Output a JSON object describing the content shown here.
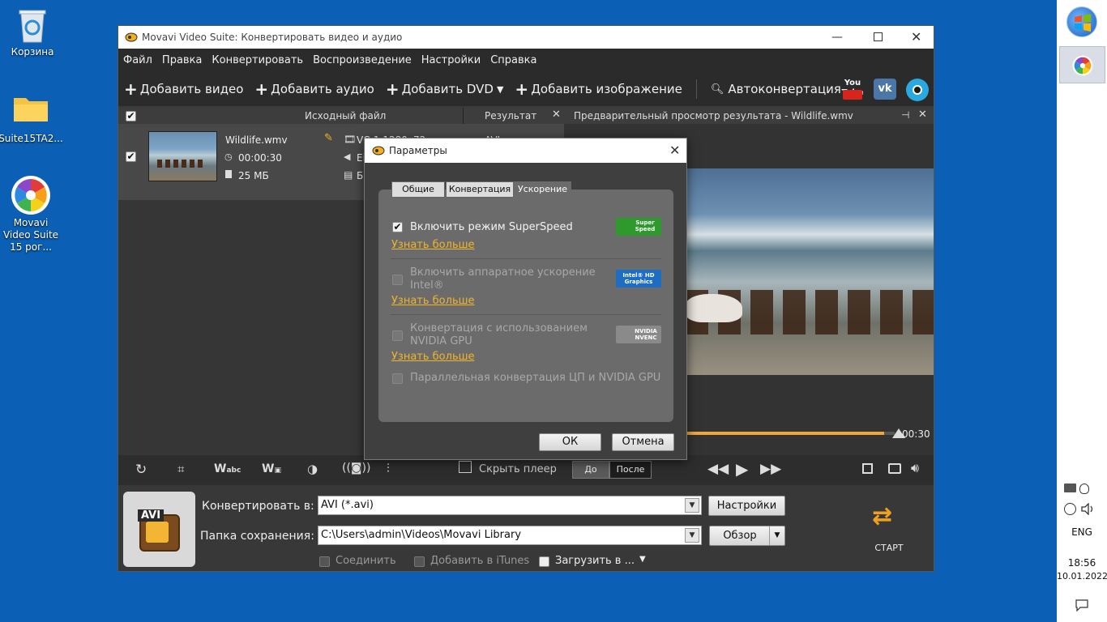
{
  "desktop": {
    "icons": [
      {
        "label": "Корзина"
      },
      {
        "label": "Suite15TA2..."
      },
      {
        "label": "Movavi Video Suite 15 рог..."
      }
    ]
  },
  "taskbar": {
    "lang": "ENG",
    "time": "18:56",
    "date": "10.01.2022"
  },
  "window": {
    "title": "Movavi Video Suite: Конвертировать видео и аудио",
    "menu": [
      "Файл",
      "Правка",
      "Конвертировать",
      "Воспроизведение",
      "Настройки",
      "Справка"
    ],
    "toolbar": {
      "add_video": "Добавить видео",
      "add_audio": "Добавить аудио",
      "add_dvd": "Добавить DVD",
      "add_image": "Добавить изображение",
      "autoconvert": "Автоконвертация",
      "youtube": "You Tube"
    },
    "list": {
      "col_source": "Исходный файл",
      "col_result": "Результат",
      "file_name": "Wildlife.wmv",
      "duration": "00:00:30",
      "size": "25 МБ",
      "codec": "VC-1 1280x72",
      "audio": "Ei",
      "subs": "Бе",
      "result_format": "AVI"
    },
    "preview": {
      "title": "Предварительный просмотр результата - Wildlife.wmv",
      "time_end": "00:30",
      "progress_fraction": 0.95
    },
    "controls": {
      "hide_player": "Скрыть плеер",
      "before": "До",
      "after": "После"
    },
    "bottom": {
      "format_badge": "AVI",
      "convert_to_label": "Конвертировать в:",
      "convert_to_value": "AVI (*.avi)",
      "settings_btn": "Настройки",
      "save_folder_label": "Папка сохранения:",
      "save_folder_value": "C:\\Users\\admin\\Videos\\Movavi Library",
      "browse_btn": "Обзор",
      "join_label": "Соединить",
      "itunes_label": "Добавить в iTunes",
      "upload_label": "Загрузить в ...",
      "start_label": "СТАРТ"
    }
  },
  "dialog": {
    "title": "Параметры",
    "tabs": [
      "Общие",
      "Конвертация",
      "Ускорение"
    ],
    "options": [
      {
        "label": "Включить режим SuperSpeed",
        "checked": true,
        "enabled": true,
        "badge": "Super Speed"
      },
      {
        "label": "Включить аппаратное ускорение Intel®",
        "checked": false,
        "enabled": false,
        "badge": "Intel® HD Graphics"
      },
      {
        "label": "Конвертация с использованием NVIDIA GPU",
        "checked": false,
        "enabled": false,
        "badge": "NVIDIA NVENC"
      },
      {
        "label": "Параллельная конвертация ЦП и NVIDIA GPU",
        "checked": false,
        "enabled": false
      }
    ],
    "learn_more": "Узнать больше",
    "ok": "ОК",
    "cancel": "Отмена"
  }
}
